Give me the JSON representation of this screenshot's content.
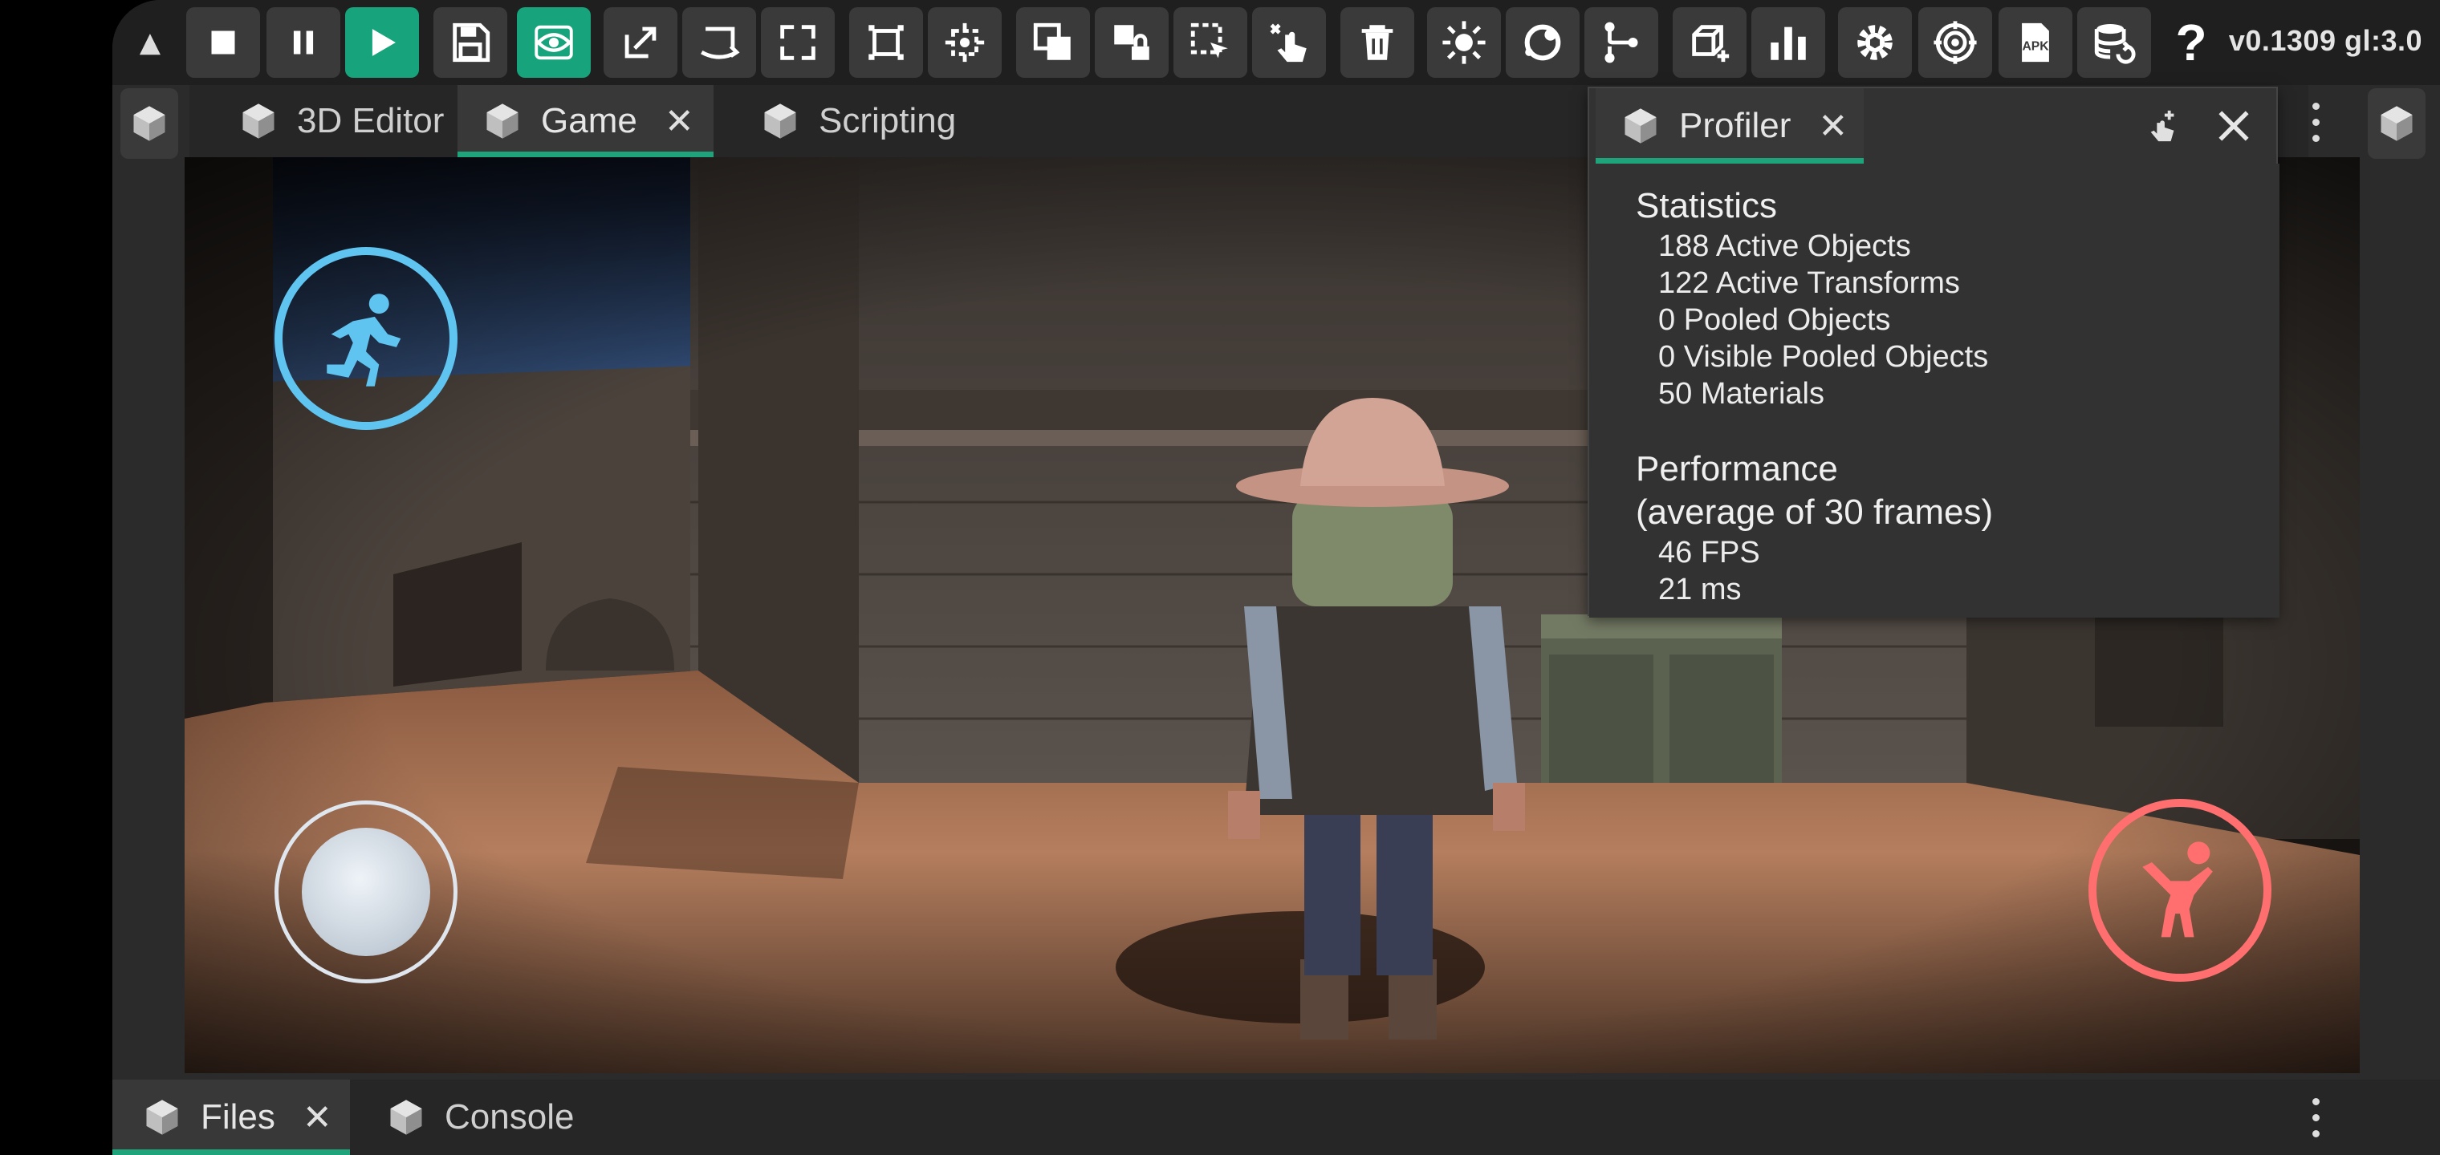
{
  "toolbar": {
    "collapse_glyph": "▲",
    "version": "v0.1309 gl:3.0",
    "buttons": [
      {
        "name": "stop-icon"
      },
      {
        "name": "pause-icon"
      },
      {
        "name": "play-icon"
      },
      {
        "name": "save-icon"
      },
      {
        "name": "eye-icon"
      },
      {
        "name": "move-tool-icon"
      },
      {
        "name": "rotate-tool-icon"
      },
      {
        "name": "scale-tool-icon"
      },
      {
        "name": "bounds-icon"
      },
      {
        "name": "pivot-icon"
      },
      {
        "name": "duplicate-icon"
      },
      {
        "name": "lock-icon"
      },
      {
        "name": "select-icon"
      },
      {
        "name": "touch-select-icon"
      },
      {
        "name": "trash-icon"
      },
      {
        "name": "light-icon"
      },
      {
        "name": "sphere-icon"
      },
      {
        "name": "graph-icon"
      },
      {
        "name": "add-object-icon"
      },
      {
        "name": "bar-chart-icon"
      },
      {
        "name": "settings-icon"
      },
      {
        "name": "target-settings-icon"
      },
      {
        "name": "apk-icon"
      },
      {
        "name": "database-icon"
      },
      {
        "name": "help-icon"
      }
    ],
    "apk_label": "APK",
    "help_glyph": "?"
  },
  "tabs": {
    "main": [
      {
        "label": "3D Editor",
        "active": false
      },
      {
        "label": "Game",
        "active": true
      },
      {
        "label": "Scripting",
        "active": false
      }
    ],
    "close_glyph": "✕"
  },
  "profiler": {
    "tab_label": "Profiler",
    "close_glyph": "✕",
    "sections": {
      "statistics_title": "Statistics",
      "statistics": [
        "188 Active Objects",
        "122 Active Transforms",
        "0 Pooled Objects",
        "0 Visible Pooled Objects",
        "50 Materials"
      ],
      "performance_title_1": "Performance",
      "performance_title_2": "(average of 30 frames)",
      "performance": [
        "46 FPS",
        "21 ms"
      ]
    }
  },
  "bottom_tabs": [
    {
      "label": "Files",
      "active": true
    },
    {
      "label": "Console",
      "active": false
    }
  ],
  "colors": {
    "accent": "#1fa37a",
    "run_button": "#5fc4f0",
    "jump_button": "#ff6f6f"
  }
}
